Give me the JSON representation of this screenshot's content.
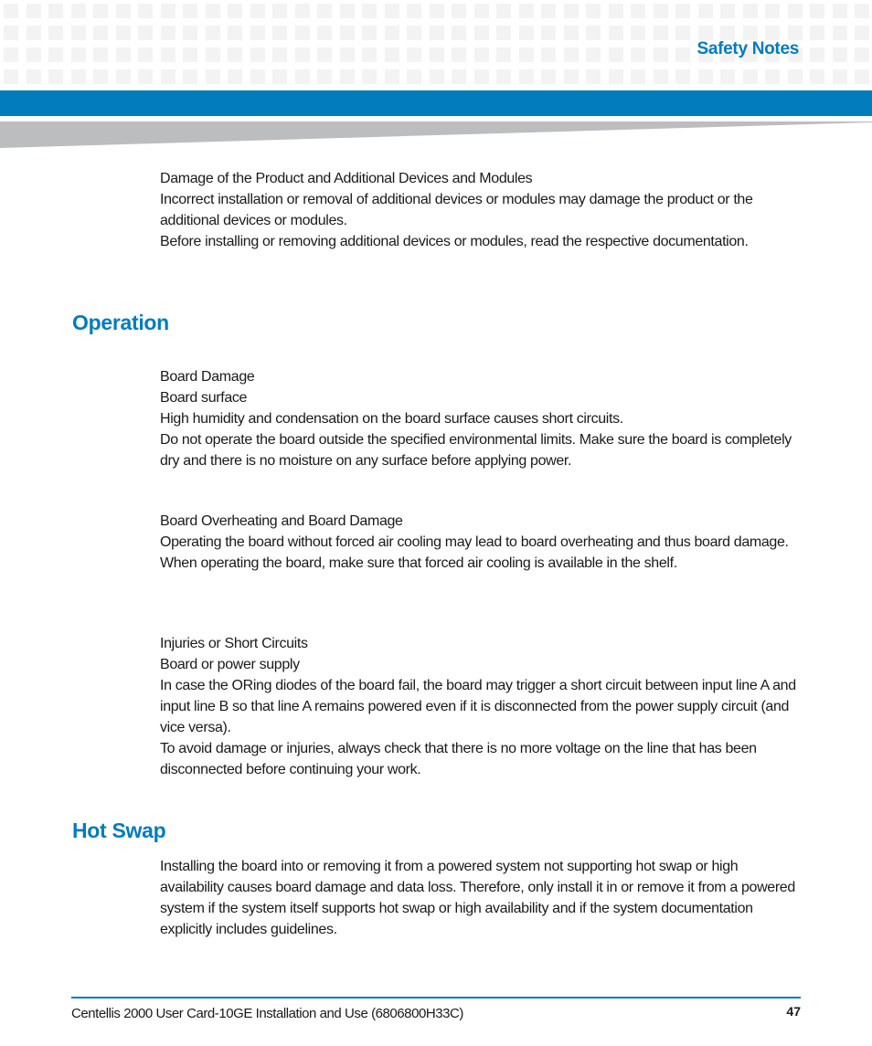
{
  "header": {
    "section_title": "Safety Notes",
    "accent_color": "#027cbd"
  },
  "intro_notice": {
    "lines": [
      "Damage of the Product and Additional Devices and Modules",
      "Incorrect installation or removal of additional devices or modules may damage the product or the additional devices or modules.",
      "Before installing or removing additional devices or modules, read the respective documentation."
    ]
  },
  "operation": {
    "title": "Operation",
    "notices": [
      {
        "lines": [
          "Board Damage",
          "Board surface",
          "High humidity and condensation on the board surface causes short circuits.",
          "Do not operate the board outside the specified environmental limits. Make sure the board is completely dry and there is no moisture on any surface before applying power."
        ]
      },
      {
        "lines": [
          "Board Overheating and Board Damage",
          "Operating the board without forced air cooling may lead to board overheating and thus board damage.",
          "When operating the board, make sure that forced air cooling is available in the shelf."
        ]
      },
      {
        "lines": [
          "Injuries or Short Circuits",
          "Board or power supply",
          "In case the ORing diodes of the board fail, the board may trigger a short circuit between input line A and input line B so that line A remains powered even if it is disconnected from the power supply circuit (and vice versa).",
          "To avoid damage or injuries, always check that there is no more voltage on the line that has been disconnected before continuing your work."
        ]
      }
    ]
  },
  "hot_swap": {
    "title": "Hot Swap",
    "text": "Installing the board into or removing it from a powered system not supporting hot swap or high availability causes board damage and data loss. Therefore, only install it in or remove it from a powered system if the system itself supports hot swap or high availability and if the system documentation explicitly includes guidelines."
  },
  "footer": {
    "document_title": "Centellis 2000 User Card-10GE Installation and Use (6806800H33C)",
    "page_number": "47"
  }
}
